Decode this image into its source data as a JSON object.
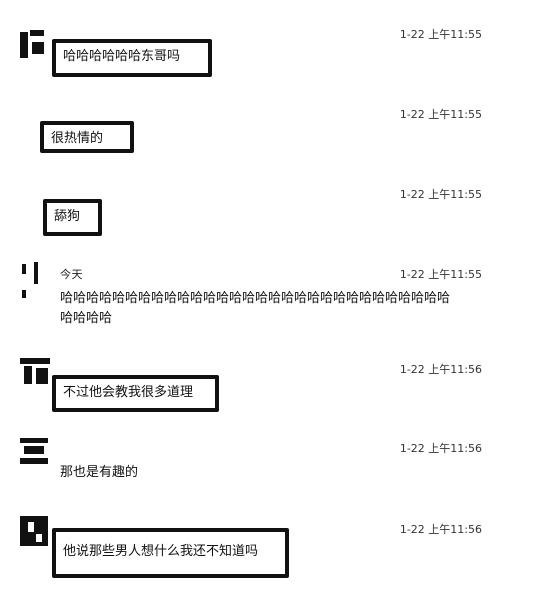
{
  "messages": [
    {
      "name": "",
      "timestamp": "1-22 上午11:55",
      "text": "哈哈哈哈哈哈东哥吗"
    },
    {
      "name": "",
      "timestamp": "1-22 上午11:55",
      "text": "很热情的"
    },
    {
      "name": "",
      "timestamp": "1-22 上午11:55",
      "text": "舔狗"
    },
    {
      "name": "今天",
      "timestamp": "1-22 上午11:55",
      "text": "哈哈哈哈哈哈哈哈哈哈哈哈哈哈哈哈哈哈哈哈哈哈哈哈哈哈哈哈哈哈哈哈哈哈"
    },
    {
      "name": "",
      "timestamp": "1-22 上午11:56",
      "text": "不过他会教我很多道理"
    },
    {
      "name": "",
      "timestamp": "1-22 上午11:56",
      "text": "那也是有趣的"
    },
    {
      "name": "",
      "timestamp": "1-22 上午11:56",
      "text": "他说那些男人想什么我还不知道吗"
    }
  ]
}
